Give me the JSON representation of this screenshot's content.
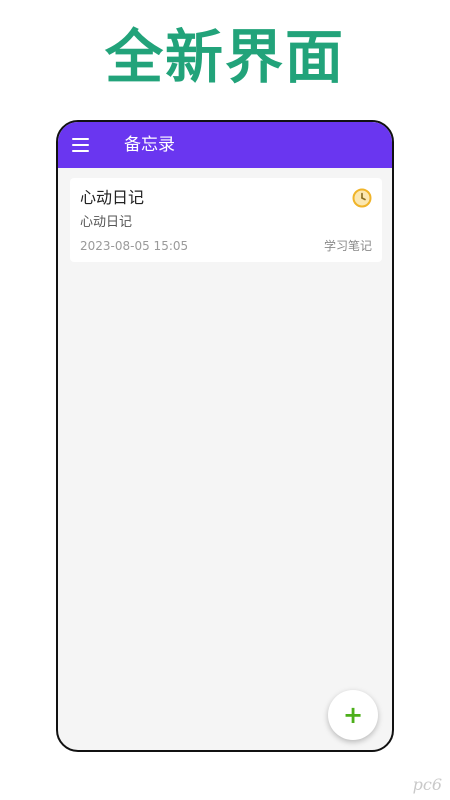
{
  "promo": {
    "headline": "全新界面"
  },
  "app": {
    "title": "备忘录",
    "accent_color": "#6a36f0",
    "menu_icon": "hamburger-menu-icon"
  },
  "notes": [
    {
      "title": "心动日记",
      "content": "心动日记",
      "date": "2023-08-05 15:05",
      "category": "学习笔记",
      "reminder_icon": "clock-icon"
    }
  ],
  "fab": {
    "label": "+",
    "icon": "plus-icon",
    "color": "#4caf1a"
  },
  "watermark": {
    "text": "pc6"
  }
}
